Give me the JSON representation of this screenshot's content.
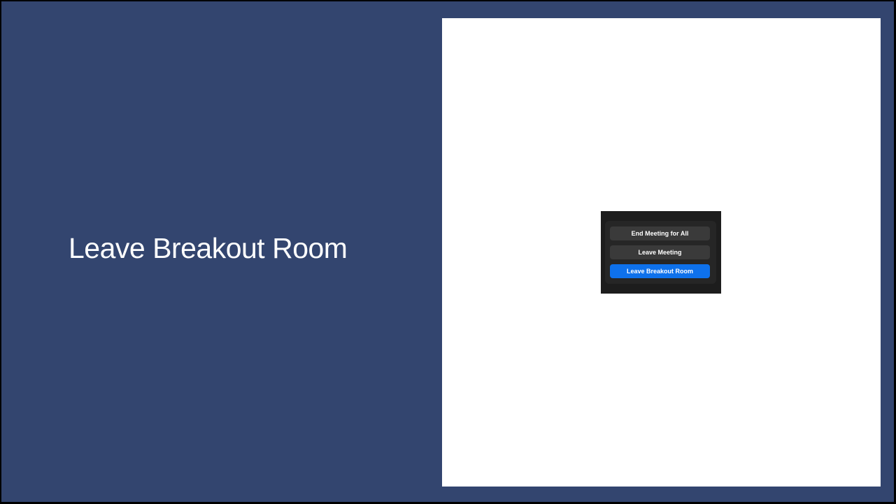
{
  "slide": {
    "title": "Leave Breakout Room"
  },
  "dialog": {
    "buttons": {
      "end_meeting_for_all": "End Meeting for All",
      "leave_meeting": "Leave Meeting",
      "leave_breakout_room": "Leave Breakout Room"
    }
  },
  "colors": {
    "slide_background": "#33456f",
    "dialog_background": "#1d1d1d",
    "secondary_button": "#3a3a3a",
    "primary_button": "#0e71eb"
  }
}
